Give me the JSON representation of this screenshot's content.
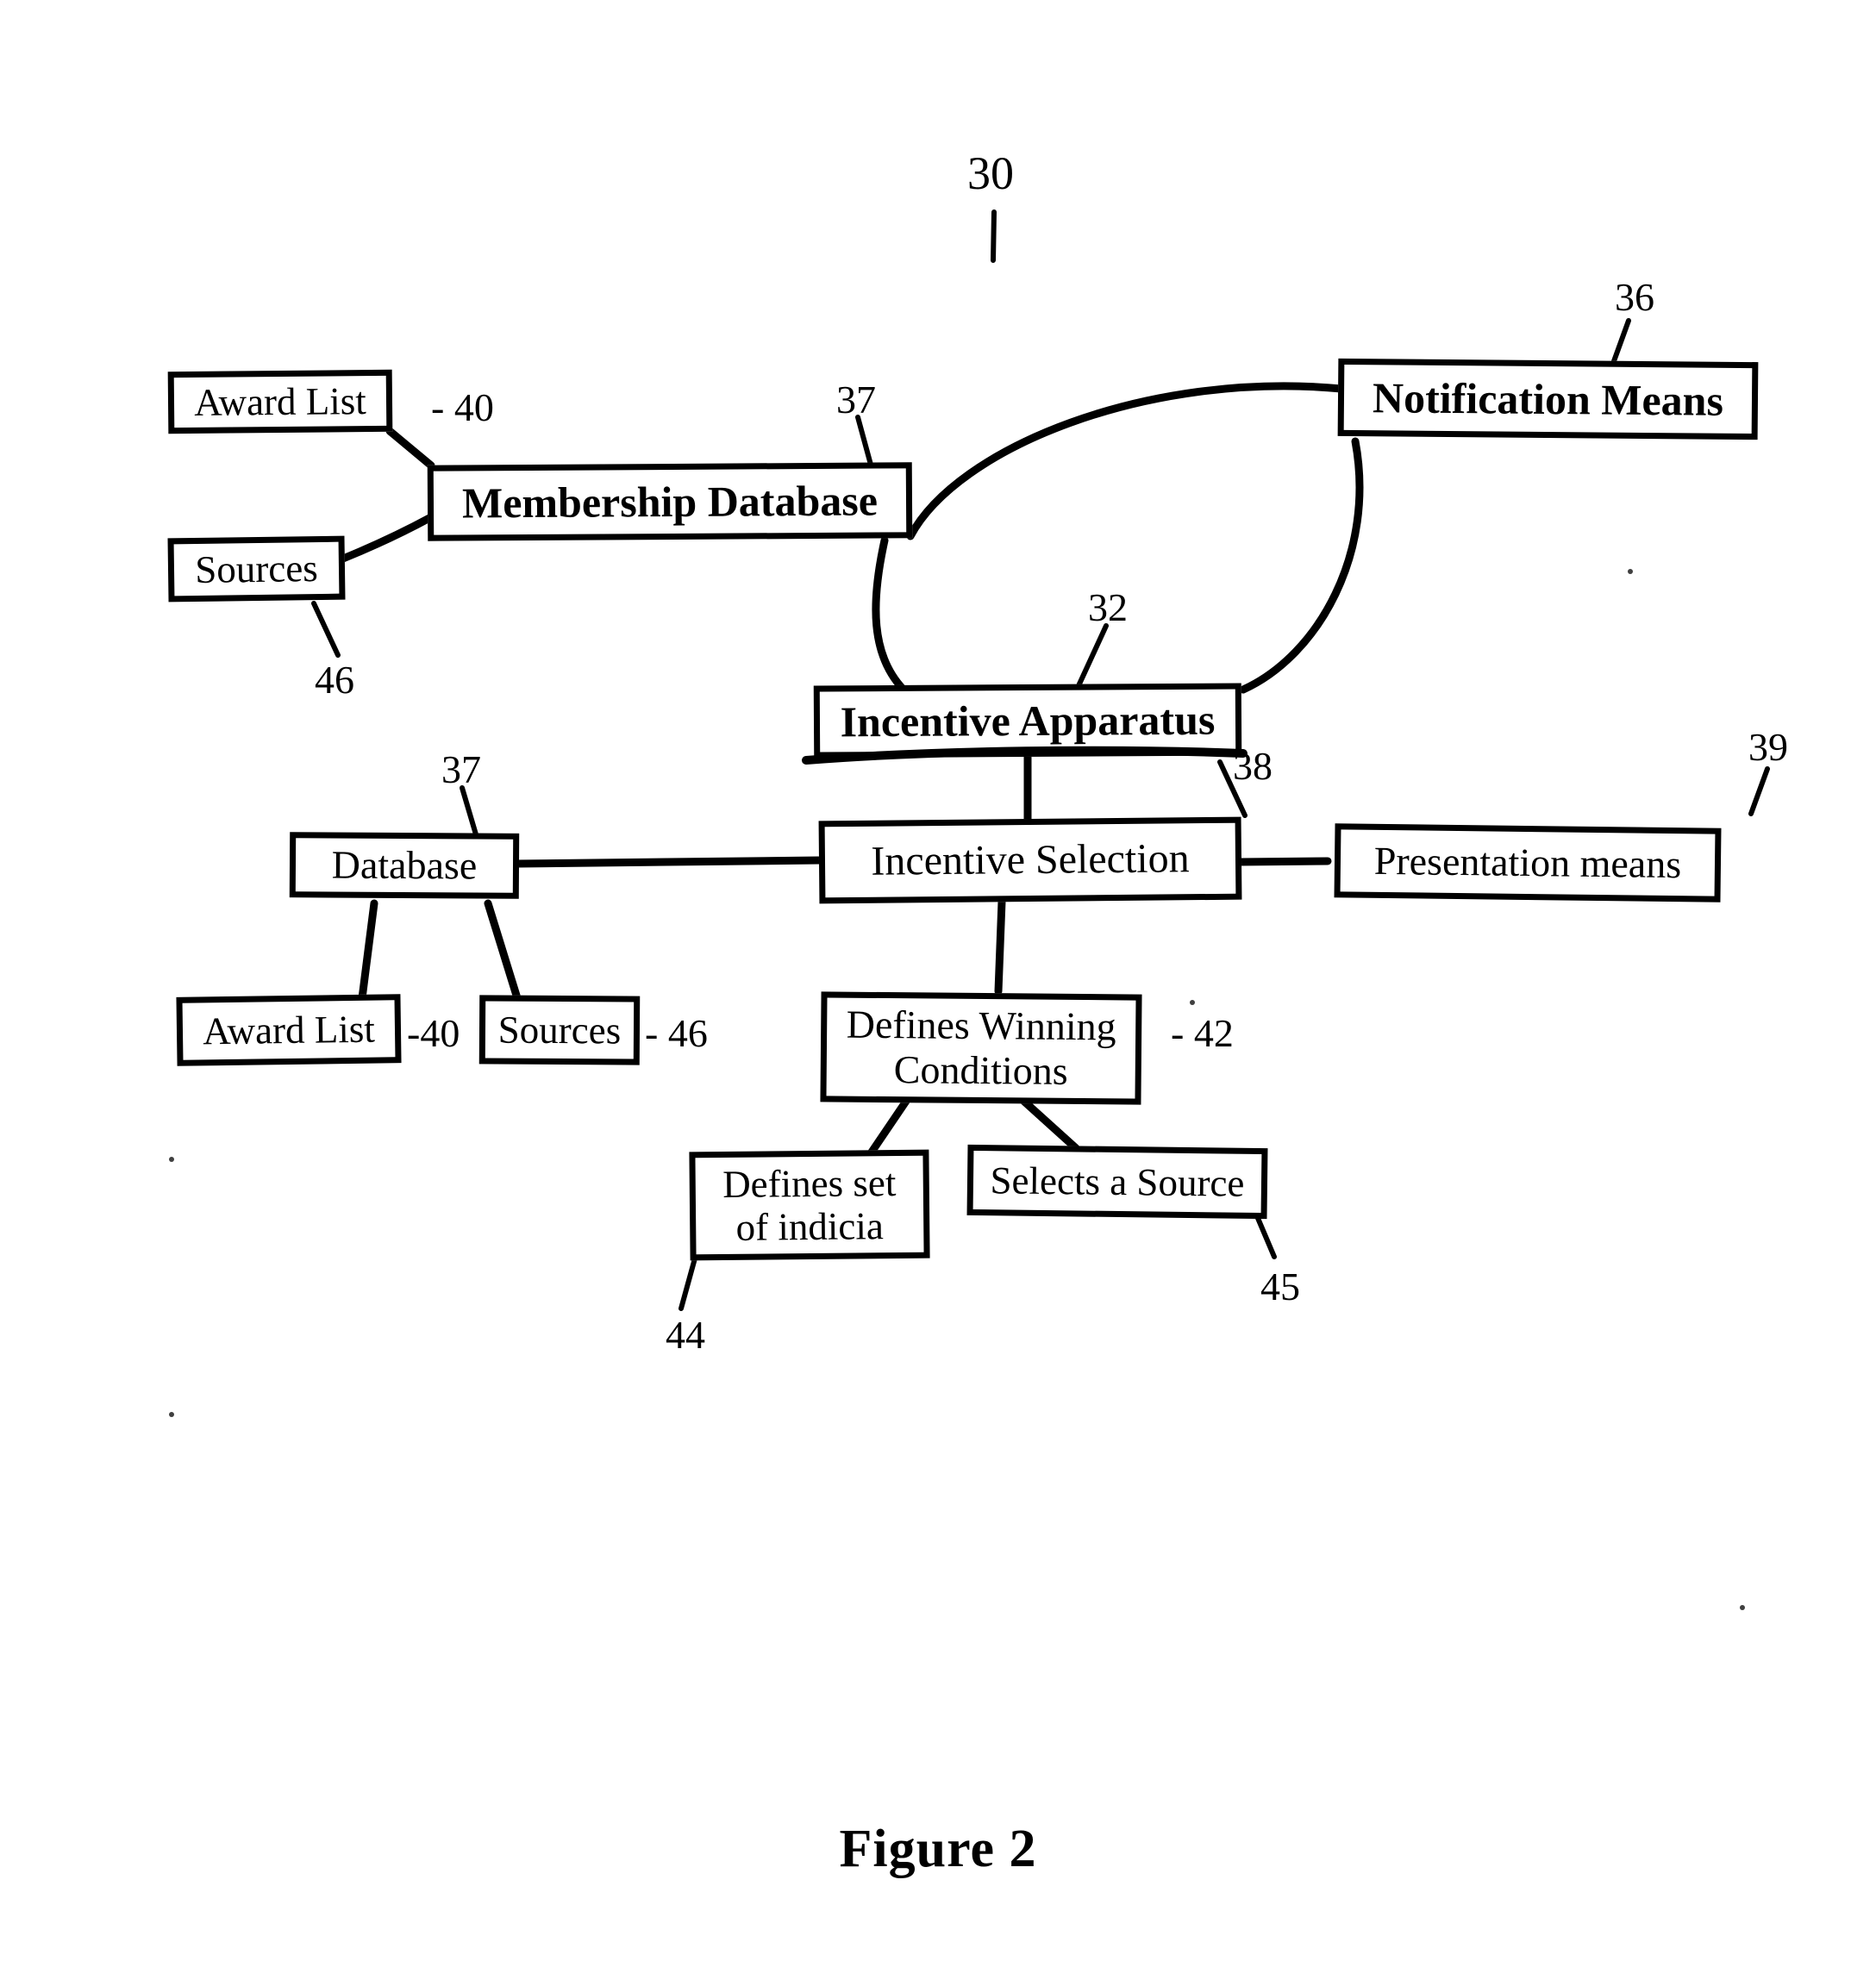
{
  "figure": {
    "caption": "Figure 2",
    "top_ref": "30"
  },
  "nodes": [
    {
      "id": "award-list-top",
      "label": "Award List",
      "ref": "- 40",
      "bold": false
    },
    {
      "id": "sources-top",
      "label": "Sources",
      "ref": "46",
      "bold": false
    },
    {
      "id": "membership-database",
      "label": "Membership Database",
      "ref": "37",
      "bold": true
    },
    {
      "id": "notification-means",
      "label": "Notification Means",
      "ref": "36",
      "bold": true
    },
    {
      "id": "incentive-apparatus",
      "label": "Incentive Apparatus",
      "ref": "32",
      "bold": true
    },
    {
      "id": "database",
      "label": "Database",
      "ref": "37",
      "bold": false
    },
    {
      "id": "incentive-selection",
      "label": "Incentive Selection",
      "ref": "38",
      "bold": false
    },
    {
      "id": "presentation-means",
      "label": "Presentation means",
      "ref": "39",
      "bold": false
    },
    {
      "id": "award-list-bottom",
      "label": "Award List",
      "ref": "-40",
      "bold": false
    },
    {
      "id": "sources-bottom",
      "label": "Sources",
      "ref": "- 46",
      "bold": false
    },
    {
      "id": "defines-winning",
      "label": "Defines Winning\nConditions",
      "ref": "- 42",
      "bold": false
    },
    {
      "id": "defines-indicia",
      "label": "Defines set\nof indicia",
      "ref": "44",
      "bold": false
    },
    {
      "id": "selects-source",
      "label": "Selects a Source",
      "ref": "45",
      "bold": false
    }
  ],
  "ref_labels": {
    "top_30": "30",
    "md_37": "37",
    "nm_36": "36",
    "award_top_40": "- 40",
    "sources_top_46": "46",
    "ia_32": "32",
    "is_38": "38",
    "db_37": "37",
    "pm_39": "39",
    "award_bottom_40": "-40",
    "sources_bottom_46": "- 46",
    "dw_42": "- 42",
    "di_44": "44",
    "ss_45": "45"
  },
  "colors": {
    "ink": "#000000",
    "paper": "#ffffff"
  }
}
